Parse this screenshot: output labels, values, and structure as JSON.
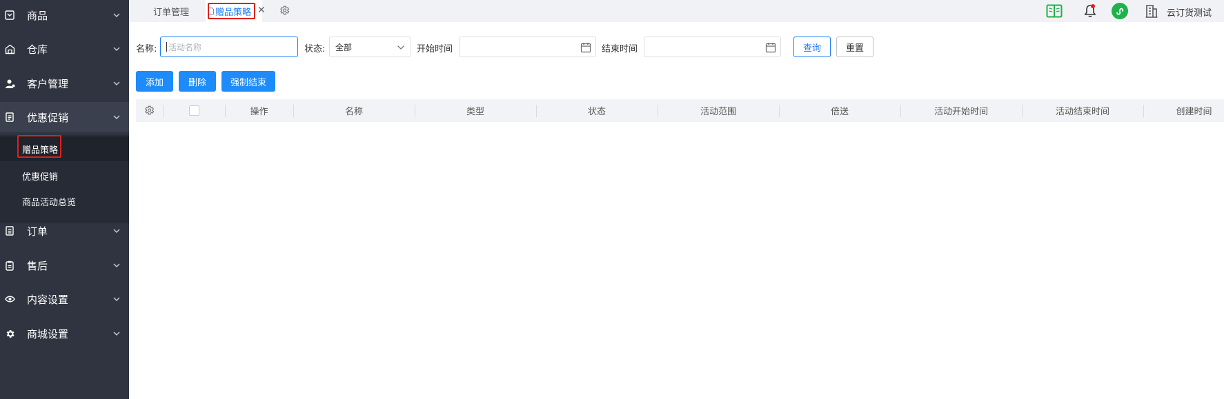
{
  "sidebar": {
    "items": [
      {
        "label": "商品",
        "icon": "box-icon"
      },
      {
        "label": "仓库",
        "icon": "warehouse-icon"
      },
      {
        "label": "客户管理",
        "icon": "user-icon"
      },
      {
        "label": "优惠促销",
        "icon": "document-icon"
      },
      {
        "label": "订单",
        "icon": "list-icon"
      },
      {
        "label": "售后",
        "icon": "clipboard-icon"
      },
      {
        "label": "内容设置",
        "icon": "eye-icon"
      },
      {
        "label": "商城设置",
        "icon": "gear-icon"
      }
    ],
    "sub_items": [
      {
        "label": "赠品策略"
      },
      {
        "label": "优惠促销"
      },
      {
        "label": "商品活动总览"
      }
    ]
  },
  "tabs": {
    "items": [
      {
        "label": "订单管理"
      },
      {
        "label": "赠品策略"
      }
    ],
    "close_glyph": "✕"
  },
  "header": {
    "store_name": "云订货测试",
    "notification_color": "#e0201c",
    "mini_program_color": "#21b04b"
  },
  "filters": {
    "name_label": "名称:",
    "name_placeholder": "活动名称",
    "status_label": "状态:",
    "status_value": "全部",
    "start_label": "开始时间",
    "end_label": "结束时间",
    "query_button": "查询",
    "reset_button": "重置"
  },
  "actions": {
    "add": "添加",
    "delete": "删除",
    "force_end": "强制结束"
  },
  "table": {
    "columns": [
      "操作",
      "名称",
      "类型",
      "状态",
      "活动范围",
      "倍送",
      "活动开始时间",
      "活动结束时间",
      "创建时间"
    ]
  },
  "colors": {
    "sidebar_bg": "#2f3440",
    "primary": "#1d8cfa",
    "highlight": "#e0201c"
  }
}
